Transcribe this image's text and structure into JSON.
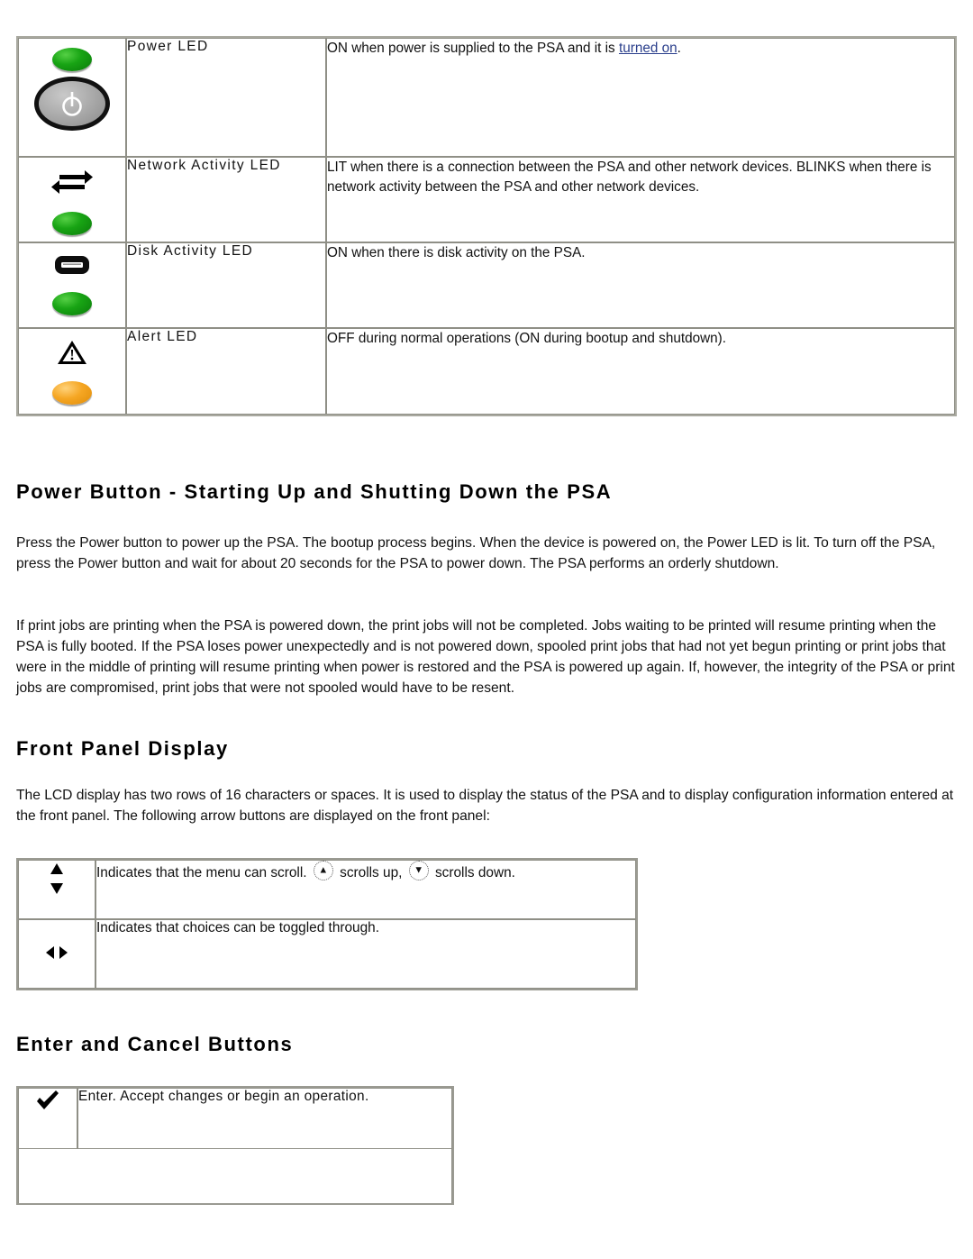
{
  "led_table": {
    "rows": [
      {
        "icon": "power-button-led-icon",
        "label": "Power LED",
        "desc_before": "ON when power is supplied to the PSA and it is ",
        "link": "turned on",
        "desc_after": "."
      },
      {
        "icon": "network-activity-led-icon",
        "label": "Network Activity LED",
        "desc": "LIT when there is a connection between the PSA and other network devices. BLINKS when there is network activity between the PSA and other network devices."
      },
      {
        "icon": "disk-activity-led-icon",
        "label": "Disk Activity LED",
        "desc": "ON when there is disk activity on the PSA."
      },
      {
        "icon": "alert-led-icon",
        "label": "Alert LED",
        "desc": "OFF during normal operations (ON during bootup and shutdown)."
      }
    ]
  },
  "power_section": {
    "heading": "Power Button - Starting Up and Shutting Down the PSA",
    "paragraph1": "Press the Power button to power up the PSA. The bootup process begins. When the device is powered on, the Power LED is lit. To turn off the PSA, press the Power button and wait for about 20 seconds for the PSA to power down. The PSA performs an orderly shutdown.",
    "paragraph2": "If print jobs are printing when the PSA is powered down, the print jobs will not be completed. Jobs waiting to be printed will resume printing when the PSA is fully booted. If the PSA loses power unexpectedly and is not powered down, spooled print jobs that had not yet begun printing or print jobs that were in the middle of printing will resume printing when power is restored and the PSA is powered up again. If, however, the integrity of the PSA or print jobs are compromised, print jobs that were not spooled would have to be resent."
  },
  "front_panel_section": {
    "heading": "Front Panel Display",
    "paragraph": "The LCD display has two rows of 16 characters or spaces. It is used to display the status of the PSA and to display configuration information entered at the front panel. The following arrow buttons are displayed on the front panel:",
    "rows": [
      {
        "icon": "up-down-arrow-icon",
        "text_part1": "Indicates that the menu can scroll.",
        "text_part2": "scrolls up,",
        "text_part3": "scrolls down.",
        "up_icon": "scroll-up-button-icon",
        "down_icon": "scroll-down-button-icon"
      },
      {
        "icon": "left-right-arrow-icon",
        "text": "Indicates that choices can be toggled through."
      }
    ]
  },
  "enter_cancel_section": {
    "heading": "Enter and Cancel Buttons",
    "rows": [
      {
        "icon": "checkmark-icon",
        "text": "Enter. Accept changes or begin an operation."
      }
    ]
  },
  "colors": {
    "led_green": "#18a414",
    "led_amber": "#f5a623",
    "link": "#2b3f8c",
    "table_border": "#8f8f86"
  }
}
